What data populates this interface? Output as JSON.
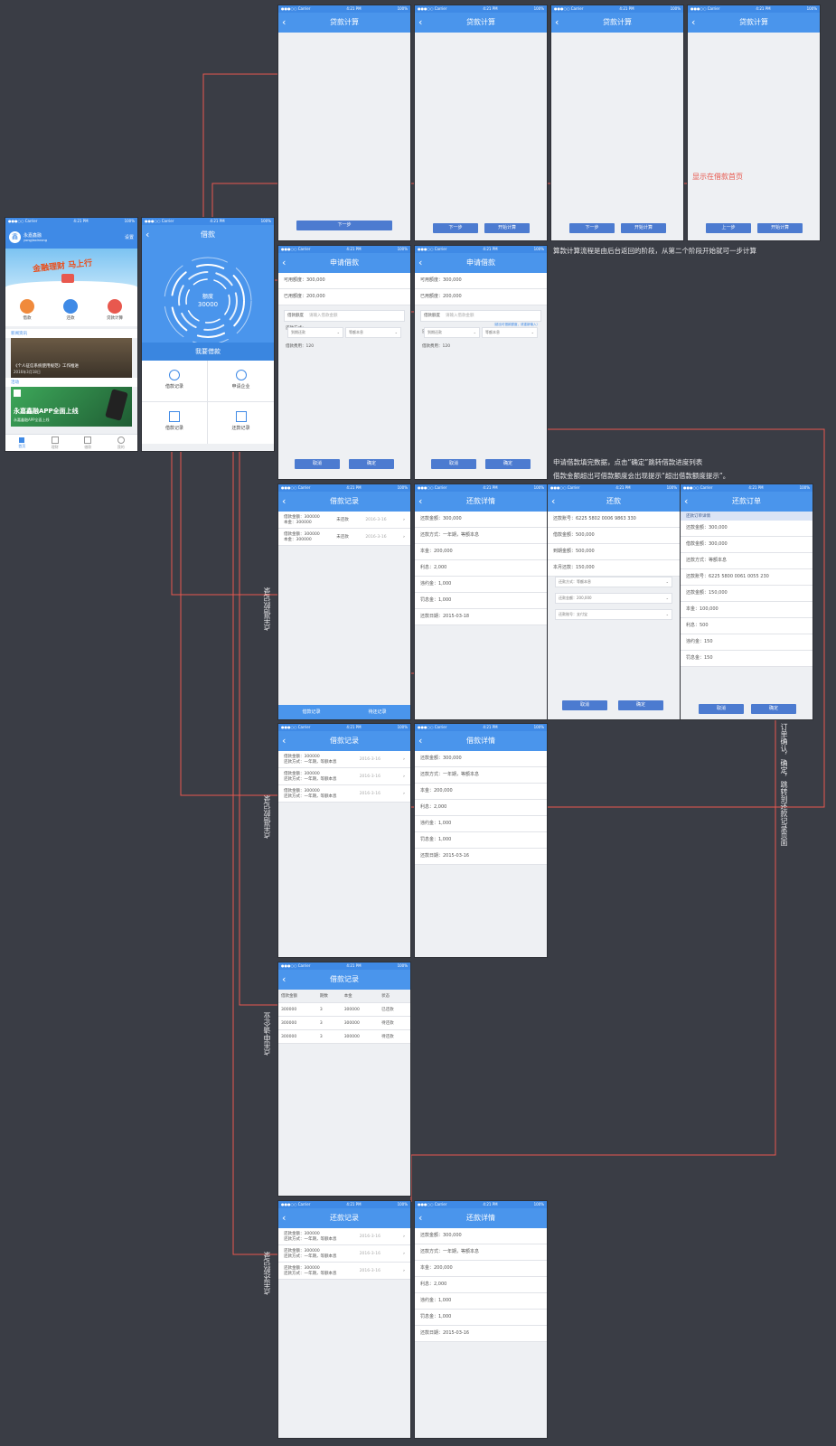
{
  "status_bar": {
    "carrier": "●●●○○ Carrier",
    "time": "4:21 PM",
    "battery": "100%"
  },
  "back_glyph": "‹",
  "home": {
    "brand": "永嘉鑫融",
    "brand_sub": "yongjiaxinrong",
    "top_right": "设置",
    "banner": "金融理财 马上行",
    "tiles": [
      "借款",
      "还款",
      "贷款计算"
    ],
    "news_header": "新闻资讯",
    "news_title": "《个人征信系统使用规范》工作推进",
    "news_date": "2016年3月18日",
    "app_header": "活动",
    "app_title": "永嘉鑫融APP全面上线",
    "app_sub": "永嘉鑫融APP全面上线",
    "tabbar": [
      "首页",
      "理财",
      "借款",
      "我的"
    ]
  },
  "loan_home": {
    "title": "借款",
    "credit_label": "额度",
    "credit_value": "30000",
    "apply_label": "我要借款",
    "menu": [
      "借款记录",
      "申请企业",
      "借款记录",
      "还款记录"
    ]
  },
  "calc_screens": [
    {
      "title": "贷款计算",
      "buttons": [
        "下一步"
      ]
    },
    {
      "title": "贷款计算",
      "buttons": [
        "下一步",
        "开始计算"
      ]
    },
    {
      "title": "贷款计算",
      "buttons": [
        "下一步",
        "开始计算"
      ]
    },
    {
      "title": "贷款计算",
      "buttons": [
        "上一步",
        "开始计算"
      ]
    }
  ],
  "apply_a": {
    "title": "申请借款",
    "fields": [
      "可用额度：300,000",
      "已用额度：200,000"
    ],
    "amount_label": "借款额度",
    "amount_placeholder": "请输入借款金额",
    "method_label": "还款方式：",
    "sel_a": "到期还款",
    "sel_b": "等额本息",
    "fee": "借款费用：120",
    "buttons": [
      "取消",
      "确定"
    ]
  },
  "apply_b": {
    "title": "申请借款",
    "fields": [
      "可用额度：300,000",
      "已用额度：200,000"
    ],
    "amount_label": "借款额度",
    "amount_placeholder": "请输入借款金额",
    "hint": "（超出可借款额度，请重新输入）",
    "method_label": "还款方式：",
    "sel_a": "到期还款",
    "sel_b": "等额本息",
    "fee": "借款费用：120",
    "buttons": [
      "取消",
      "确定"
    ]
  },
  "records": {
    "title": "借款记录",
    "items": [
      {
        "l1": "借款金额：300000",
        "l2": "本金：300000",
        "status": "未还款",
        "date": "2016-3-16"
      },
      {
        "l1": "借款金额：300000",
        "l2": "本金：300000",
        "status": "未还款",
        "date": "2016-3-16"
      }
    ],
    "tabs": [
      "借款记录",
      "待还记录"
    ]
  },
  "repay_detail": {
    "title": "还款详情",
    "fields": [
      "还款金额：300,000",
      "还款方式：一年期，等额本息",
      "本金：200,000",
      "利息：2,000",
      "违约金：1,000",
      "罚息金：1,000",
      "还款日期：2015-03-18"
    ]
  },
  "repay_form": {
    "title": "还款",
    "fields": [
      "还款账号：6225 5802 0006 9863 330",
      "借款金额：500,000",
      "到期金额：500,000",
      "本月还款：150,000"
    ],
    "selects": [
      "还款方式：等额本息",
      "还款金额：200,000",
      "还款账号：支付宝"
    ],
    "buttons": [
      "取消",
      "确定"
    ]
  },
  "repay_order": {
    "title": "还款订单",
    "header": "还款订单详情",
    "fields": [
      "还款金额：300,000",
      "借款金额：300,000",
      "还款方式：等额本息",
      "还款账号：6225 5800 0061 0055 230",
      "还款金额：150,000",
      "本金：100,000",
      "利息：500",
      "违约金：150",
      "罚息金：150"
    ],
    "buttons": [
      "取消",
      "确定"
    ]
  },
  "records2": {
    "title": "借款记录",
    "items": [
      {
        "l1": "借款金额：300000",
        "l2": "还款方式：一年期，等额本息",
        "date": "2016-3-16"
      },
      {
        "l1": "借款金额：300000",
        "l2": "还款方式：一年期，等额本息",
        "date": "2016-3-16"
      },
      {
        "l1": "借款金额：300000",
        "l2": "还款方式：一年期，等额本息",
        "date": "2016-3-16"
      }
    ]
  },
  "loan_detail": {
    "title": "借款详情",
    "fields": [
      "还款金额：300,000",
      "还款方式：一年期，等额本息",
      "本金：200,000",
      "利息：2,000",
      "违约金：1,000",
      "罚息金：1,000",
      "还款日期：2015-03-16"
    ]
  },
  "enterprise": {
    "title": "借款记录",
    "headers": [
      "借款金额",
      "期数",
      "本金",
      "状态"
    ],
    "rows": [
      [
        "300000",
        "3",
        "300000",
        "已还款"
      ],
      [
        "300000",
        "3",
        "300000",
        "待还款"
      ],
      [
        "300000",
        "3",
        "300000",
        "待还款"
      ]
    ]
  },
  "repay_records": {
    "title": "还款记录",
    "items": [
      {
        "l1": "还款金额：300000",
        "l2": "还款方式：一年期，等额本息",
        "date": "2016-3-16"
      },
      {
        "l1": "还款金额：300000",
        "l2": "还款方式：一年期，等额本息",
        "date": "2016-3-16"
      },
      {
        "l1": "还款金额：300000",
        "l2": "还款方式：一年期，等额本息",
        "date": "2016-3-16"
      }
    ]
  },
  "repay_detail2": {
    "title": "还款详情",
    "fields": [
      "还款金额：300,000",
      "还款方式：一年期，等额本息",
      "本金：200,000",
      "利息：2,000",
      "违约金：1,000",
      "罚息金：1,000",
      "还款日期：2015-03-16"
    ]
  },
  "annotations": {
    "home_page": "显示在借款首页",
    "calc_note": "算款计算流程是由后台返回的阶段，从第二个阶段开始就可一步计算",
    "apply_note_1": "申请借款填完数据，点击“确定”跳转借款进度列表",
    "apply_note_2": "借款金额超出可借款额度会出现提示“超出借款额度提示”。",
    "v_apply": "点击借款记录",
    "v_record": "点击借款记录",
    "v_enterprise": "点击申请企业",
    "v_repay": "点击还款记录",
    "v_confirm": "订单确认，确定，跳转到还款记录页面"
  },
  "colors": {
    "accent": "#4a95ec",
    "line": "#e8584e",
    "bg": "#3a3d45"
  }
}
